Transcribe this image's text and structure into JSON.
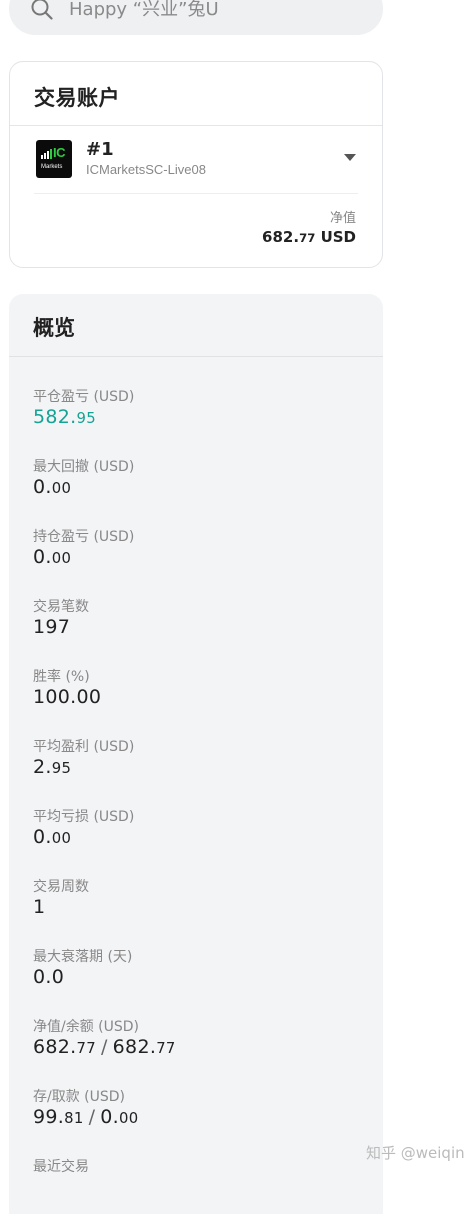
{
  "search": {
    "placeholder": "Happy “兴业”兔U",
    "icon": "search-icon"
  },
  "account_card": {
    "title": "交易账户",
    "broker_logo": {
      "text_top": "IC",
      "text_bottom": "Markets",
      "accent_color": "#2ecc40",
      "background_color": "#0b0b0b"
    },
    "account_number": "#1",
    "server": "ICMarketsSC-Live08",
    "dropdown_icon": "caret-down-icon",
    "equity_label": "净值",
    "equity_main": "682.",
    "equity_decimals": "77",
    "equity_currency": "USD"
  },
  "overview": {
    "title": "概览",
    "positive_color": "#15a394",
    "metrics": [
      {
        "label": "平仓盈亏 (USD)",
        "main": "582.",
        "decimals": "95"
      },
      {
        "label": "最大回撤 (USD)",
        "main": "0.",
        "decimals": "00"
      },
      {
        "label": "持仓盈亏 (USD)",
        "main": "0.",
        "decimals": "00"
      },
      {
        "label": "交易笔数",
        "main": "197",
        "decimals": ""
      },
      {
        "label": "胜率 (%)",
        "main": "100.00",
        "decimals": ""
      },
      {
        "label": "平均盈利 (USD)",
        "main": "2.",
        "decimals": "95"
      },
      {
        "label": "平均亏损 (USD)",
        "main": "0.",
        "decimals": "00"
      },
      {
        "label": "交易周数",
        "main": "1",
        "decimals": ""
      },
      {
        "label": "最大衰落期 (天)",
        "main": "0.0",
        "decimals": ""
      },
      {
        "label": "净值/余额 (USD)",
        "main": "682.",
        "decimals": "77",
        "separator": "/",
        "main2": "682.",
        "decimals2": "77"
      },
      {
        "label": "存/取款 (USD)",
        "main": "99.",
        "decimals": "81",
        "separator": "/",
        "main2": "0.",
        "decimals2": "00"
      },
      {
        "label": "最近交易",
        "main": "",
        "decimals": ""
      }
    ]
  },
  "watermark": "知乎 @weiqing"
}
